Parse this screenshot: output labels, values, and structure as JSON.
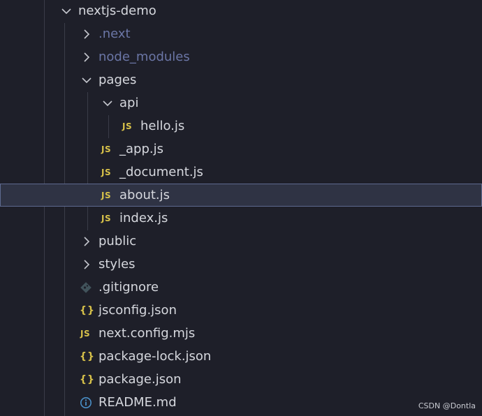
{
  "tree": {
    "root": {
      "label": "nextjs-demo",
      "expanded": true
    },
    "next": {
      "label": ".next",
      "expanded": false
    },
    "node_modules": {
      "label": "node_modules",
      "expanded": false
    },
    "pages": {
      "label": "pages",
      "expanded": true
    },
    "api": {
      "label": "api",
      "expanded": true
    },
    "hello": {
      "label": "hello.js",
      "icon": "JS"
    },
    "app": {
      "label": "_app.js",
      "icon": "JS"
    },
    "document": {
      "label": "_document.js",
      "icon": "JS"
    },
    "about": {
      "label": "about.js",
      "icon": "JS",
      "selected": true
    },
    "index": {
      "label": "index.js",
      "icon": "JS"
    },
    "public": {
      "label": "public",
      "expanded": false
    },
    "styles": {
      "label": "styles",
      "expanded": false
    },
    "gitignore": {
      "label": ".gitignore",
      "icon": "git-diamond-icon"
    },
    "jsconfig": {
      "label": "jsconfig.json",
      "icon": "{}"
    },
    "nextconfig": {
      "label": "next.config.mjs",
      "icon": "JS"
    },
    "packagelock": {
      "label": "package-lock.json",
      "icon": "{}"
    },
    "package": {
      "label": "package.json",
      "icon": "{}"
    },
    "readme": {
      "label": "README.md",
      "icon": "info-icon"
    }
  },
  "colors": {
    "background": "#1e1f29",
    "text": "#d6d8de",
    "dimmed_text": "#6b76a6",
    "js_icon": "#d8c24a",
    "info_icon": "#4a90c8",
    "selection_bg": "#2f3344",
    "selection_border": "#5e6a90"
  },
  "watermark": "CSDN @Dontla"
}
